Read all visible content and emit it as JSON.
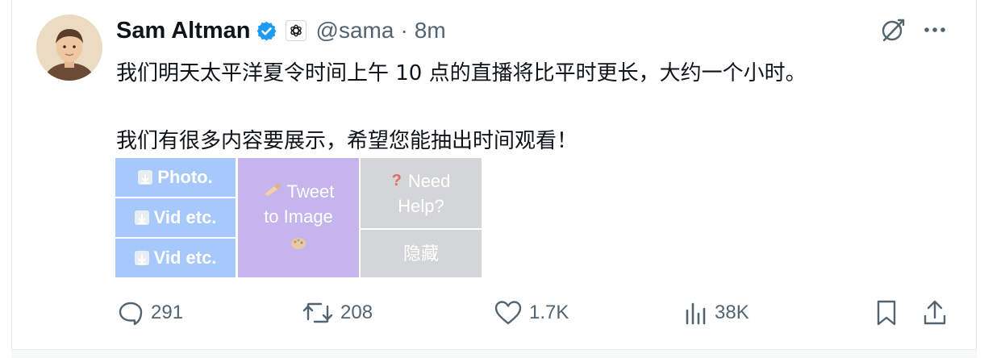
{
  "tweet": {
    "display_name": "Sam Altman",
    "handle": "@sama",
    "separator": "·",
    "time": "8m",
    "verified_icon": "verified-badge-icon",
    "affiliate_icon": "openai-logo-icon",
    "text_line1": "我们明天太平洋夏令时间上午 10 点的直播将比平时更长，大约一个小时。",
    "text_line2": "我们有很多内容要展示，希望您能抽出时间观看！"
  },
  "media_buttons": {
    "photo": "Photo.",
    "vid1": "Vid etc.",
    "vid2": "Vid etc.",
    "tweet_to_image_line1": "Tweet",
    "tweet_to_image_line2": "to Image",
    "need_help_line1": "Need",
    "need_help_line2": "Help?",
    "hide": "隐藏"
  },
  "actions": {
    "replies": "291",
    "reposts": "208",
    "likes": "1.7K",
    "views": "38K"
  },
  "colors": {
    "verified": "#1d9bf0",
    "muted": "#536471",
    "media_blue": "#a6c8fa",
    "media_purple": "#c6b5ec",
    "media_gray": "#d3d5d7"
  }
}
